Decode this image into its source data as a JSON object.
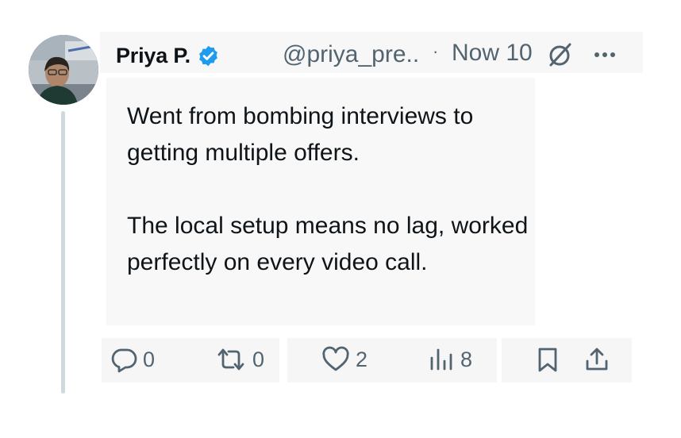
{
  "post": {
    "author_name": "Priya P.",
    "handle": "@priya_pre..",
    "separator": "·",
    "time": "Now 10",
    "body_paragraph_1": "Went from bombing interviews to getting multiple offers.",
    "body_paragraph_2": "The local setup means no lag, worked perfectly on every video call."
  },
  "actions": {
    "replies": "0",
    "reposts": "0",
    "likes": "2",
    "views": "8"
  },
  "icons": {
    "verified": "verified-badge-icon",
    "time_indicator": "timer-slash-icon",
    "more": "more-dots-icon",
    "reply": "reply-bubble-icon",
    "repost": "repost-arrows-icon",
    "like": "heart-icon",
    "views": "views-bars-icon",
    "bookmark": "bookmark-icon",
    "share": "share-upload-icon"
  },
  "colors": {
    "text": "#0f1419",
    "muted": "#536471",
    "verified_blue": "#1d9bf0",
    "thread_line": "#cfd9de"
  }
}
